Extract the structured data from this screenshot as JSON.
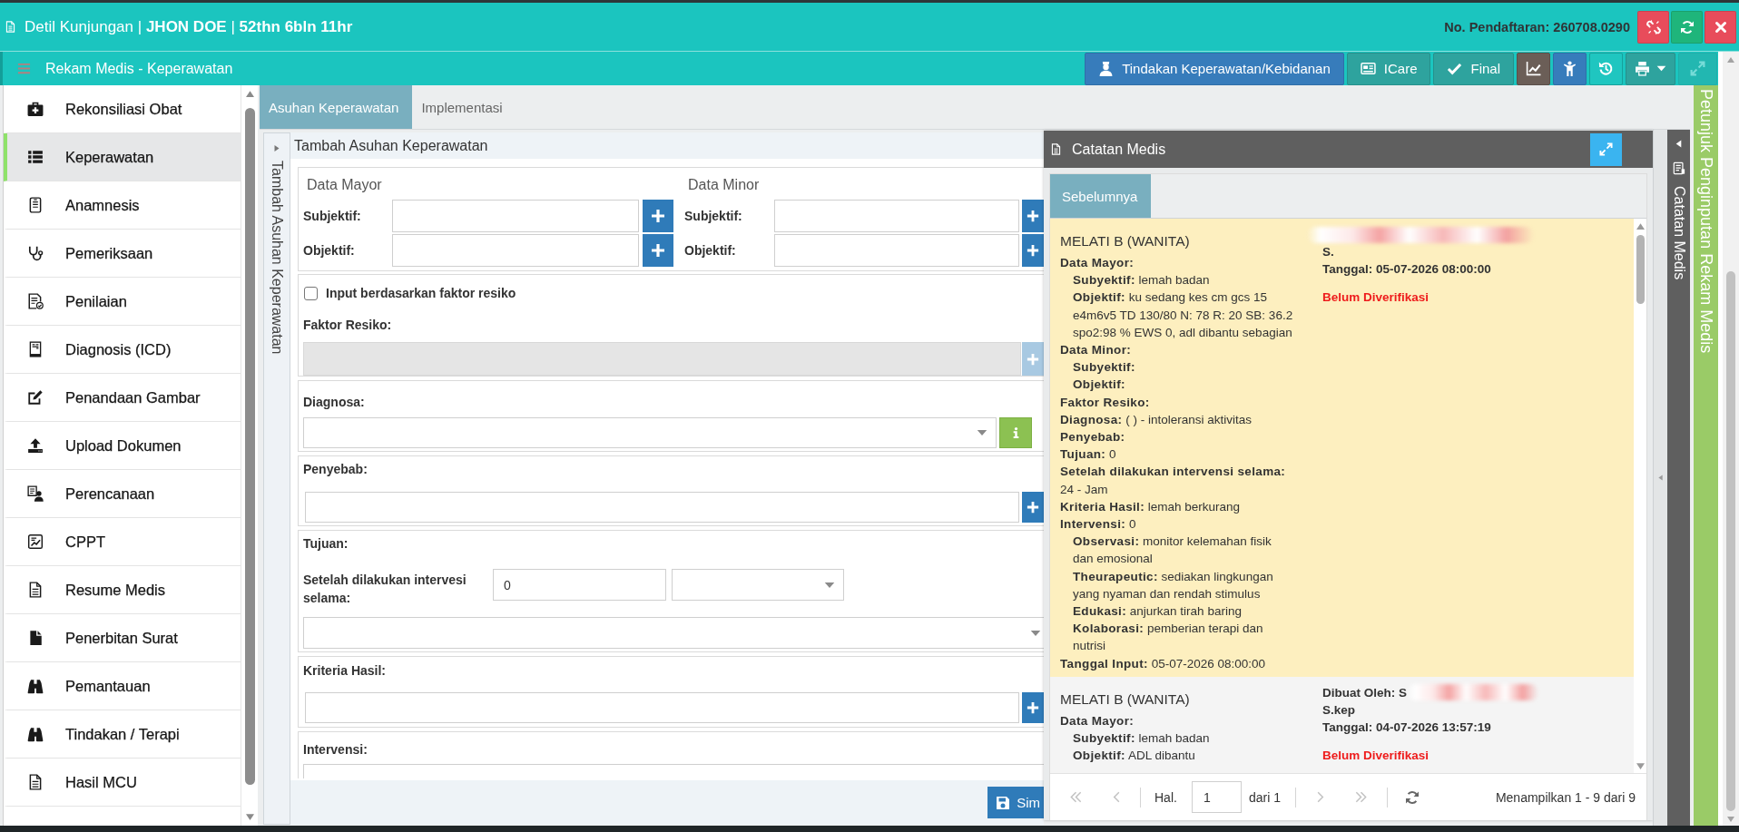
{
  "header": {
    "title": "Detil Kunjungan | **JHON DOE** | **52thn 6bln 11hr**",
    "registration": "No. Pendaftaran: 260708.0290",
    "actions": [
      {
        "kind": "danger"
      },
      {
        "kind": "success"
      },
      {
        "kind": "danger"
      }
    ]
  },
  "module_bar": {
    "title": "Rekam Medis - Keperawatan",
    "toolbar": [
      {
        "kind": "primary",
        "label": "Tindakan Keperawatan/Kebidanan",
        "disabled": false,
        "dropdown": false
      },
      {
        "kind": "default",
        "label": "ICare",
        "disabled": false,
        "dropdown": false
      },
      {
        "kind": "default",
        "label": "Final",
        "disabled": false,
        "dropdown": false
      },
      {
        "kind": "dark",
        "disabled": false,
        "dropdown": false
      },
      {
        "kind": "primary",
        "disabled": false,
        "dropdown": false
      },
      {
        "kind": "info",
        "disabled": false,
        "dropdown": false
      },
      {
        "kind": "default",
        "disabled": false,
        "dropdown": true
      },
      {
        "kind": "default",
        "disabled": true,
        "dropdown": false
      }
    ]
  },
  "sidebar": {
    "items": [
      {
        "label": "Rekonsiliasi Obat",
        "selected": false
      },
      {
        "label": "Keperawatan",
        "selected": true
      },
      {
        "label": "Anamnesis",
        "selected": false
      },
      {
        "label": "Pemeriksaan",
        "selected": false
      },
      {
        "label": "Penilaian",
        "selected": false
      },
      {
        "label": "Diagnosis (ICD)",
        "selected": false
      },
      {
        "label": "Penandaan Gambar",
        "selected": false
      },
      {
        "label": "Upload Dokumen",
        "selected": false
      },
      {
        "label": "Perencanaan",
        "selected": false
      },
      {
        "label": "CPPT",
        "selected": false
      },
      {
        "label": "Resume Medis",
        "selected": false
      },
      {
        "label": "Penerbitan Surat",
        "selected": false
      },
      {
        "label": "Pemantauan",
        "selected": false
      },
      {
        "label": "Tindakan / Terapi",
        "selected": false
      },
      {
        "label": "Hasil MCU",
        "selected": false
      }
    ]
  },
  "tabs": [
    {
      "label": "Asuhan Keperawatan",
      "selected": true
    },
    {
      "label": "Implementasi",
      "selected": false
    }
  ],
  "form_strip": {
    "label": "Tambah Asuhan Keperawatan"
  },
  "form": {
    "title": "Tambah Asuhan Keperawatan",
    "data_groups": [
      {
        "heading": "Data Mayor",
        "fields": [
          {
            "label": "Subjektif:"
          },
          {
            "label": "Objektif:"
          }
        ]
      },
      {
        "heading": "Data Minor",
        "fields": [
          {
            "label": "Subjektif:"
          },
          {
            "label": "Objektif:"
          }
        ]
      }
    ],
    "risk": {
      "checkbox_label": "Input berdasarkan faktor resiko",
      "checked": false,
      "label": "Faktor Resiko:",
      "disabled": true
    },
    "diagnosa": {
      "label": "Diagnosa:"
    },
    "penyebab": {
      "label": "Penyebab:"
    },
    "tujuan": {
      "label": "Tujuan:",
      "duration_label": "Setelah dilakukan intervesi selama:",
      "duration_value": "0"
    },
    "kriteria": {
      "label": "Kriteria Hasil:"
    },
    "intervensi": {
      "label": "Intervensi:"
    },
    "save_label": "Sim"
  },
  "notes": {
    "title": "Catatan Medis",
    "tabs": [
      {
        "label": "Sebelumnya",
        "selected": true
      }
    ],
    "entries": [
      {
        "selected": true,
        "title": "MELATI B (WANITA)",
        "lines": [
          {
            "label": "Data Mayor:",
            "children": [
              {
                "label": "Subyektif:",
                "value": "lemah badan"
              },
              {
                "label": "Objektif:",
                "value": "ku sedang kes cm gcs 15 e4m6v5 TD 130/80 N: 78 R: 20 SB: 36.2 spo2:98 % EWS 0, adl dibantu sebagian"
              }
            ]
          },
          {
            "label": "Data Minor:",
            "children": [
              {
                "label": "Subyektif:"
              },
              {
                "label": "Objektif:"
              }
            ]
          },
          {
            "label": "Faktor Resiko:"
          },
          {
            "label": "Diagnosa:",
            "value": "( ) - intoleransi aktivitas"
          },
          {
            "label": "Penyebab:"
          },
          {
            "label": "Tujuan:",
            "value": "0"
          },
          {
            "label": "Setelah dilakukan intervensi selama:",
            "value": "24 - Jam"
          },
          {
            "label": "Kriteria Hasil:",
            "value": "lemah berkurang"
          },
          {
            "label": "Intervensi:",
            "value": "0",
            "children": [
              {
                "label": "Observasi:",
                "value": "monitor kelemahan fisik dan emosional"
              },
              {
                "label": "Theurapeutic:",
                "value": "sediakan lingkungan yang nyaman dan rendah stimulus"
              },
              {
                "label": "Edukasi:",
                "value": "anjurkan tirah baring"
              },
              {
                "label": "Kolaborasi:",
                "value": "pemberian terapi dan nutrisi"
              }
            ]
          },
          {
            "label": "Tanggal Input:",
            "value": "05-07-2026 08:00:00"
          }
        ],
        "redacted": true,
        "author_continued": "S.",
        "date": "Tanggal: 05-07-2026 08:00:00",
        "status": "Belum Diverifikasi"
      },
      {
        "selected": false,
        "title": "MELATI B (WANITA)",
        "lines": [
          {
            "label": "Data Mayor:",
            "children": [
              {
                "label": "Subyektif:",
                "value": "lemah badan"
              },
              {
                "label": "Objektif:",
                "value": "ADL dibantu"
              }
            ]
          }
        ],
        "author": "Dibuat Oleh: S",
        "redacted": true,
        "author_continued": "S.kep",
        "date": "Tanggal: 04-07-2026 13:57:19",
        "status": "Belum Diverifikasi"
      }
    ],
    "pager": {
      "page_label": "Hal.",
      "page": "1",
      "total": "dari 1",
      "summary": "Menampilkan 1 - 9 dari 9",
      "nav": [
        {
          "disabled": true
        },
        {
          "disabled": true
        },
        {
          "disabled": true
        },
        {
          "disabled": true
        }
      ]
    }
  },
  "notes_strip": {
    "label": "Catatan Medis"
  },
  "guide_strip": {
    "label": "Petunjuk Penginputan Rekam Medis"
  }
}
